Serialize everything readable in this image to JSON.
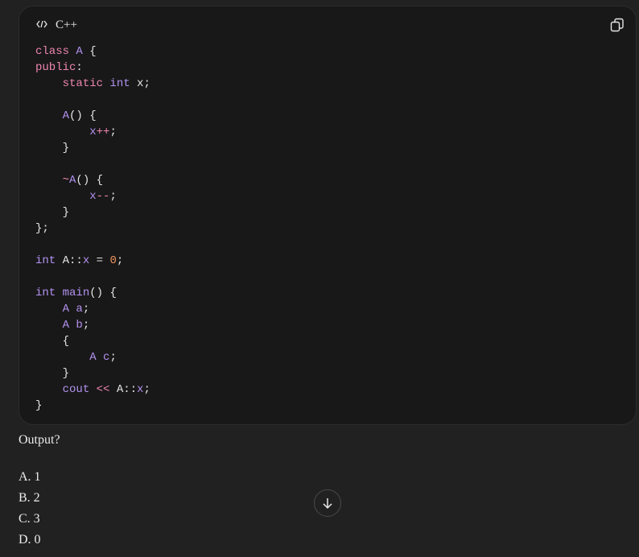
{
  "code_block": {
    "language": "C++",
    "lines": [
      [
        [
          "class ",
          "k"
        ],
        [
          "A",
          "t"
        ],
        [
          " {",
          "p"
        ]
      ],
      [
        [
          "public",
          "k"
        ],
        [
          ":",
          "p"
        ]
      ],
      [
        [
          "    ",
          "p"
        ],
        [
          "static ",
          "k"
        ],
        [
          "int",
          "t"
        ],
        [
          " x;",
          "p"
        ]
      ],
      [],
      [
        [
          "    ",
          "p"
        ],
        [
          "A",
          "t"
        ],
        [
          "() {",
          "p"
        ]
      ],
      [
        [
          "        ",
          "p"
        ],
        [
          "x",
          "t"
        ],
        [
          "++",
          "k"
        ],
        [
          ";",
          "p"
        ]
      ],
      [
        [
          "    }",
          "p"
        ]
      ],
      [],
      [
        [
          "    ",
          "p"
        ],
        [
          "~",
          "k"
        ],
        [
          "A",
          "t"
        ],
        [
          "() {",
          "p"
        ]
      ],
      [
        [
          "        ",
          "p"
        ],
        [
          "x",
          "t"
        ],
        [
          "--",
          "k"
        ],
        [
          ";",
          "p"
        ]
      ],
      [
        [
          "    }",
          "p"
        ]
      ],
      [
        [
          "};",
          "p"
        ]
      ],
      [],
      [
        [
          "int",
          "t"
        ],
        [
          " A::",
          "p"
        ],
        [
          "x",
          "t"
        ],
        [
          " = ",
          "p"
        ],
        [
          "0",
          "n"
        ],
        [
          ";",
          "p"
        ]
      ],
      [],
      [
        [
          "int",
          "t"
        ],
        [
          " ",
          "p"
        ],
        [
          "main",
          "t"
        ],
        [
          "() {",
          "p"
        ]
      ],
      [
        [
          "    ",
          "p"
        ],
        [
          "A a",
          "t"
        ],
        [
          ";",
          "p"
        ]
      ],
      [
        [
          "    ",
          "p"
        ],
        [
          "A b",
          "t"
        ],
        [
          ";",
          "p"
        ]
      ],
      [
        [
          "    {",
          "p"
        ]
      ],
      [
        [
          "        ",
          "p"
        ],
        [
          "A c",
          "t"
        ],
        [
          ";",
          "p"
        ]
      ],
      [
        [
          "    }",
          "p"
        ]
      ],
      [
        [
          "    ",
          "p"
        ],
        [
          "cout",
          "t"
        ],
        [
          " ",
          "p"
        ],
        [
          "<<",
          "k"
        ],
        [
          " A::",
          "p"
        ],
        [
          "x",
          "t"
        ],
        [
          ";",
          "p"
        ]
      ],
      [
        [
          "}",
          "p"
        ]
      ]
    ]
  },
  "question": "Output?",
  "options": [
    "A. 1",
    "B. 2",
    "C. 3",
    "D. 0"
  ]
}
